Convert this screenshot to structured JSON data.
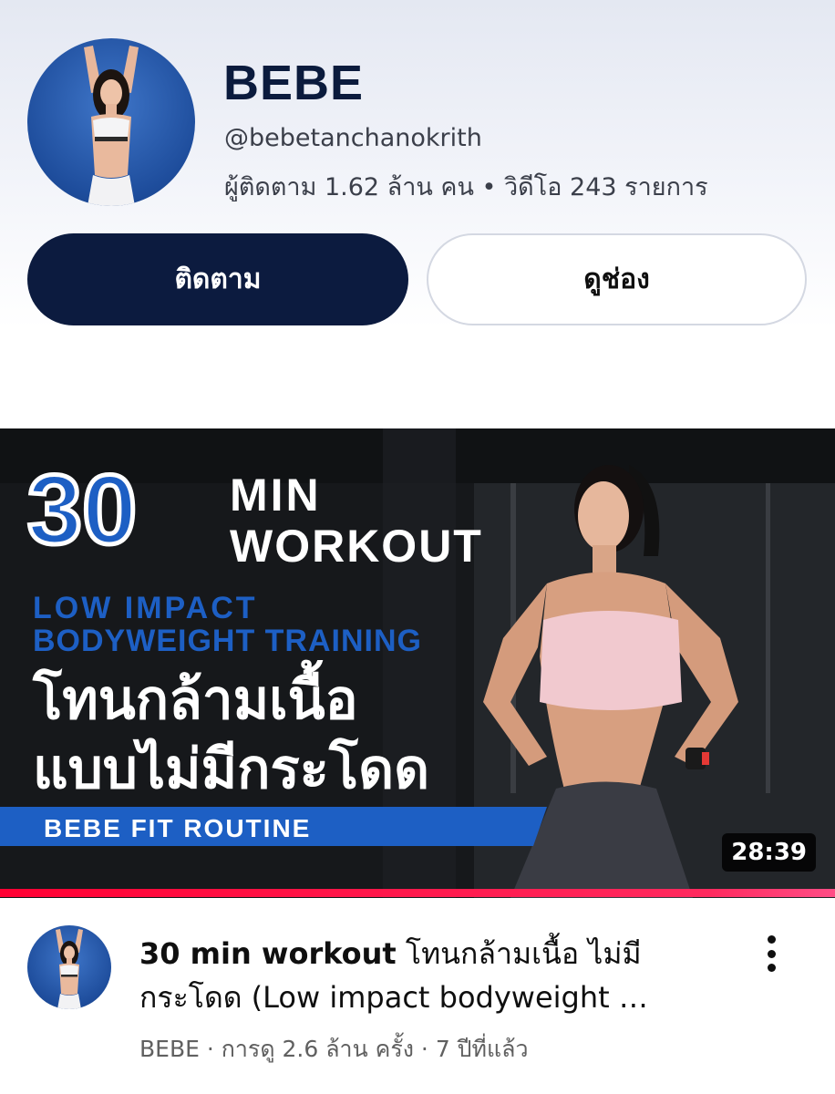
{
  "channel": {
    "name": "BEBE",
    "handle": "@bebetanchanokrith",
    "stats": "ผู้ติดตาม 1.62 ล้าน คน • วิดีโอ 243 รายการ",
    "subscribe_label": "ติดตาม",
    "view_channel_label": "ดูช่อง"
  },
  "thumbnail": {
    "number": "30",
    "line_min": "MIN",
    "line_workout": "WORKOUT",
    "line_low_impact": "LOW IMPACT",
    "line_bodyweight": "BODYWEIGHT TRAINING",
    "thai_line_1": "โทนกล้ามเนื้อ",
    "thai_line_2": "แบบไม่มีกระโดด",
    "banner": "BEBE FIT ROUTINE",
    "duration": "28:39",
    "watch_progress": 1.0,
    "accent_color": "#1d5fc4"
  },
  "video": {
    "title_en": "30 min workout",
    "title_rest_line1": " โทนกล้ามเนื้อ ไม่มี",
    "title_line2": "กระโดด (Low impact bodyweight …",
    "subline": "BEBE · การดู 2.6 ล้าน ครั้ง · 7 ปีที่แล้ว",
    "more_icon": "vertical-ellipsis-icon"
  },
  "colors": {
    "subscribe_bg": "#0c1b3f",
    "progress": "#ff0033"
  }
}
